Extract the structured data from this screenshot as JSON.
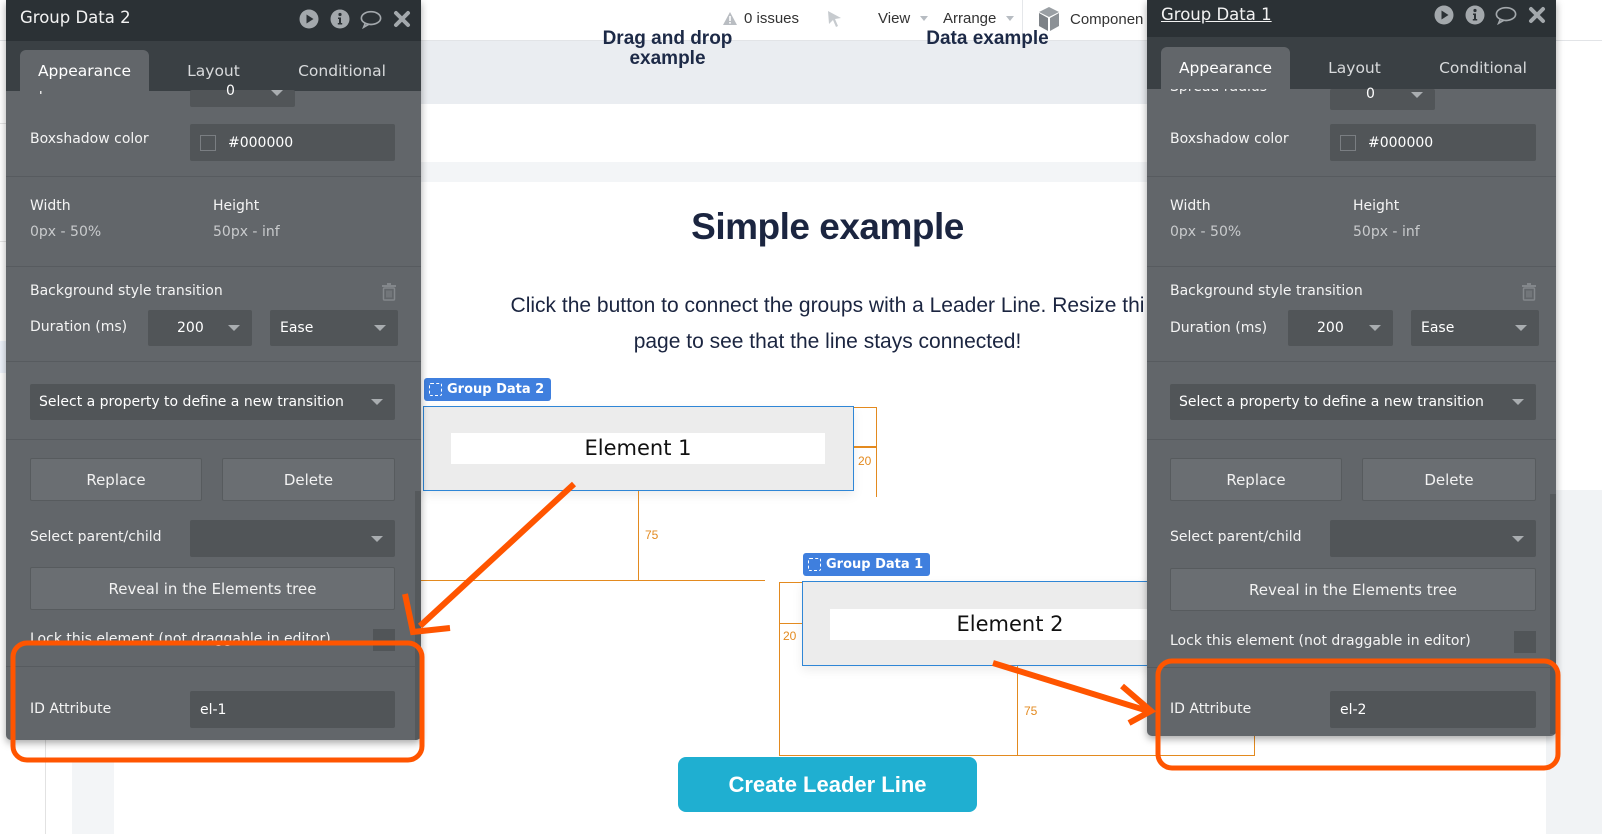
{
  "topbar": {
    "issues_label": "0 issues",
    "view_label": "View",
    "arrange_label": "Arrange",
    "components_label": "Componen"
  },
  "page": {
    "nav_links": [
      "Drag and drop\nexample",
      "Data example"
    ],
    "nav_link_1_line1": "Drag and drop",
    "nav_link_1_line2": "example",
    "nav_link_2": "Data example",
    "title": "Simple example",
    "subtitle_line1": "Click the button to connect the groups with a Leader Line. Resize thi",
    "subtitle_line2": "page to see that the line stays connected!",
    "group1": {
      "tag": "Group Data 2",
      "element_text": "Element 1"
    },
    "group2": {
      "tag": "Group Data 1",
      "element_text": "Element 2"
    },
    "measures": {
      "top_gap": "20",
      "vertical_gap": "75",
      "left_gap": "20",
      "vertical_gap_2": "75"
    },
    "create_button": "Create Leader Line",
    "colors": {
      "button": "#1fafd1",
      "group_tag": "#3f7fde",
      "measure": "#e38a1f",
      "annotation": "#ff5500"
    }
  },
  "panels": [
    {
      "title": "Group Data 2",
      "title_underlined": false,
      "tabs": [
        "Appearance",
        "Layout",
        "Conditional"
      ],
      "active_tab": "Appearance",
      "spread_radius_label": "Spread radius",
      "spread_radius_value": "0",
      "boxshadow_color_label": "Boxshadow color",
      "boxshadow_color_value": "#000000",
      "width_label": "Width",
      "width_value": "0px - 50%",
      "height_label": "Height",
      "height_value": "50px - inf",
      "transition_label": "Background style transition",
      "duration_label": "Duration (ms)",
      "duration_value": "200",
      "easing_value": "Ease",
      "new_transition_placeholder": "Select a property to define a new transition",
      "replace_label": "Replace",
      "delete_label": "Delete",
      "select_parent_label": "Select parent/child",
      "select_parent_value": "",
      "reveal_label": "Reveal in the Elements tree",
      "lock_label": "Lock this element (not draggable in editor)",
      "lock_checked": false,
      "id_attribute_label": "ID Attribute",
      "id_attribute_value": "el-1"
    },
    {
      "title": "Group Data 1",
      "title_underlined": true,
      "tabs": [
        "Appearance",
        "Layout",
        "Conditional"
      ],
      "active_tab": "Appearance",
      "spread_radius_label": "Spread radius",
      "spread_radius_value": "0",
      "boxshadow_color_label": "Boxshadow color",
      "boxshadow_color_value": "#000000",
      "width_label": "Width",
      "width_value": "0px - 50%",
      "height_label": "Height",
      "height_value": "50px - inf",
      "transition_label": "Background style transition",
      "duration_label": "Duration (ms)",
      "duration_value": "200",
      "easing_value": "Ease",
      "new_transition_placeholder": "Select a property to define a new transition",
      "replace_label": "Replace",
      "delete_label": "Delete",
      "select_parent_label": "Select parent/child",
      "select_parent_value": "",
      "reveal_label": "Reveal in the Elements tree",
      "lock_label": "Lock this element (not draggable in editor)",
      "lock_checked": false,
      "id_attribute_label": "ID Attribute",
      "id_attribute_value": "el-2"
    }
  ]
}
